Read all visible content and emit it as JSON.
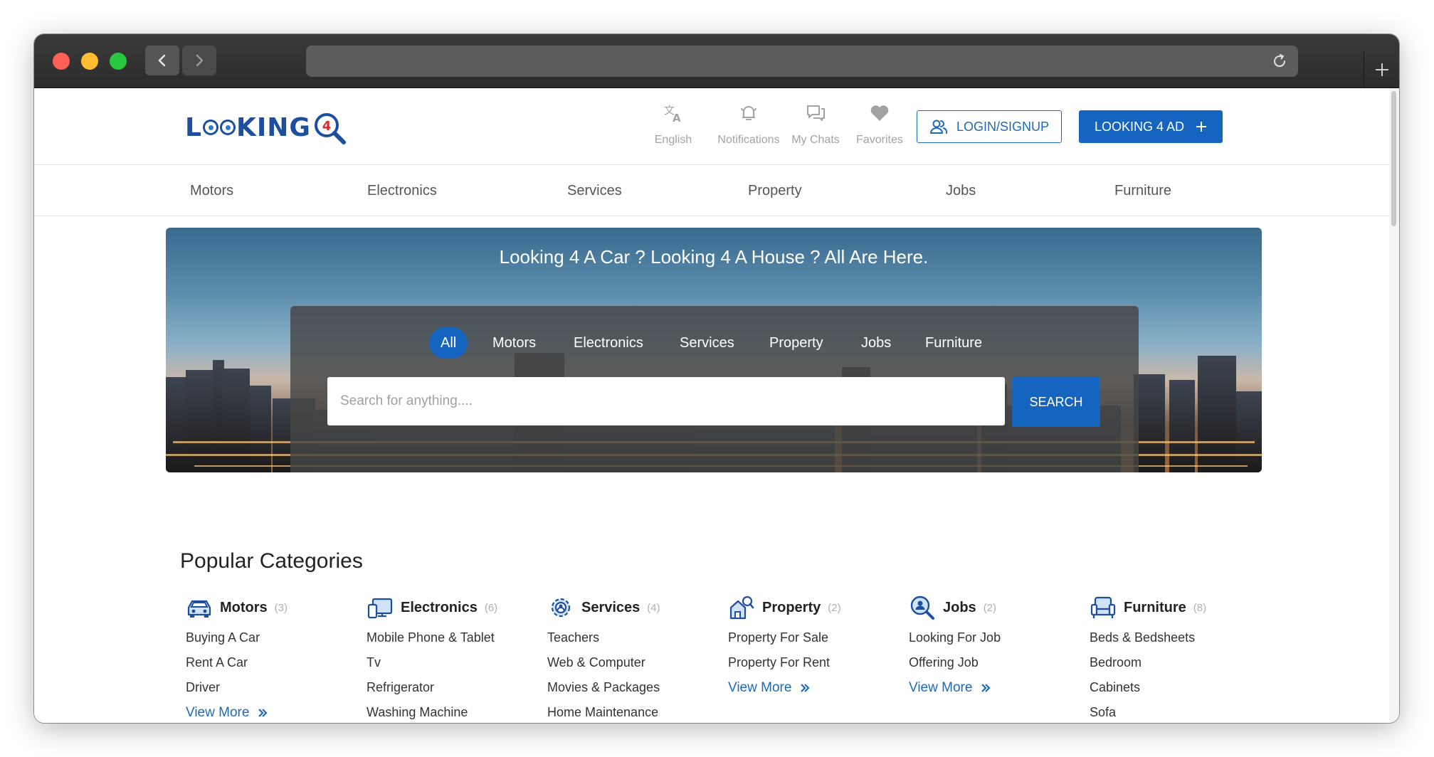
{
  "brand": {
    "logo_text": "L",
    "logo_text_2": "KING",
    "logo_badge": "4",
    "primary_color": "#1565c0",
    "logo_color": "#1d4f9e"
  },
  "header": {
    "icons": [
      {
        "label": "English",
        "icon": "translate-icon"
      },
      {
        "label": "Notifications",
        "icon": "bell-icon"
      },
      {
        "label": "My Chats",
        "icon": "chat-icon"
      },
      {
        "label": "Favorites",
        "icon": "heart-icon"
      }
    ],
    "login_label": "LOGIN/SIGNUP",
    "post_ad_label": "LOOKING 4 AD"
  },
  "nav": [
    "Motors",
    "Electronics",
    "Services",
    "Property",
    "Jobs",
    "Furniture"
  ],
  "hero": {
    "title": "Looking 4 A Car ? Looking 4 A House ? All Are Here.",
    "tabs": [
      "All",
      "Motors",
      "Electronics",
      "Services",
      "Property",
      "Jobs",
      "Furniture"
    ],
    "active_tab": "All",
    "search_placeholder": "Search for anything....",
    "search_button": "SEARCH"
  },
  "popular": {
    "title": "Popular Categories",
    "view_more": "View More",
    "columns": [
      {
        "name": "Motors",
        "count": "(3)",
        "icon": "car-icon",
        "items": [
          "Buying A Car",
          "Rent A Car",
          "Driver"
        ]
      },
      {
        "name": "Electronics",
        "count": "(6)",
        "icon": "devices-icon",
        "items": [
          "Mobile Phone & Tablet",
          "Tv",
          "Refrigerator",
          "Washing Machine"
        ]
      },
      {
        "name": "Services",
        "count": "(4)",
        "icon": "gear-icon",
        "items": [
          "Teachers",
          "Web & Computer",
          "Movies & Packages",
          "Home Maintenance"
        ]
      },
      {
        "name": "Property",
        "count": "(2)",
        "icon": "house-search-icon",
        "items": [
          "Property For Sale",
          "Property For Rent"
        ]
      },
      {
        "name": "Jobs",
        "count": "(2)",
        "icon": "job-search-icon",
        "items": [
          "Looking For Job",
          "Offering Job"
        ]
      },
      {
        "name": "Furniture",
        "count": "(8)",
        "icon": "armchair-icon",
        "items": [
          "Beds & Bedsheets",
          "Bedroom",
          "Cabinets",
          "Sofa"
        ]
      }
    ]
  }
}
